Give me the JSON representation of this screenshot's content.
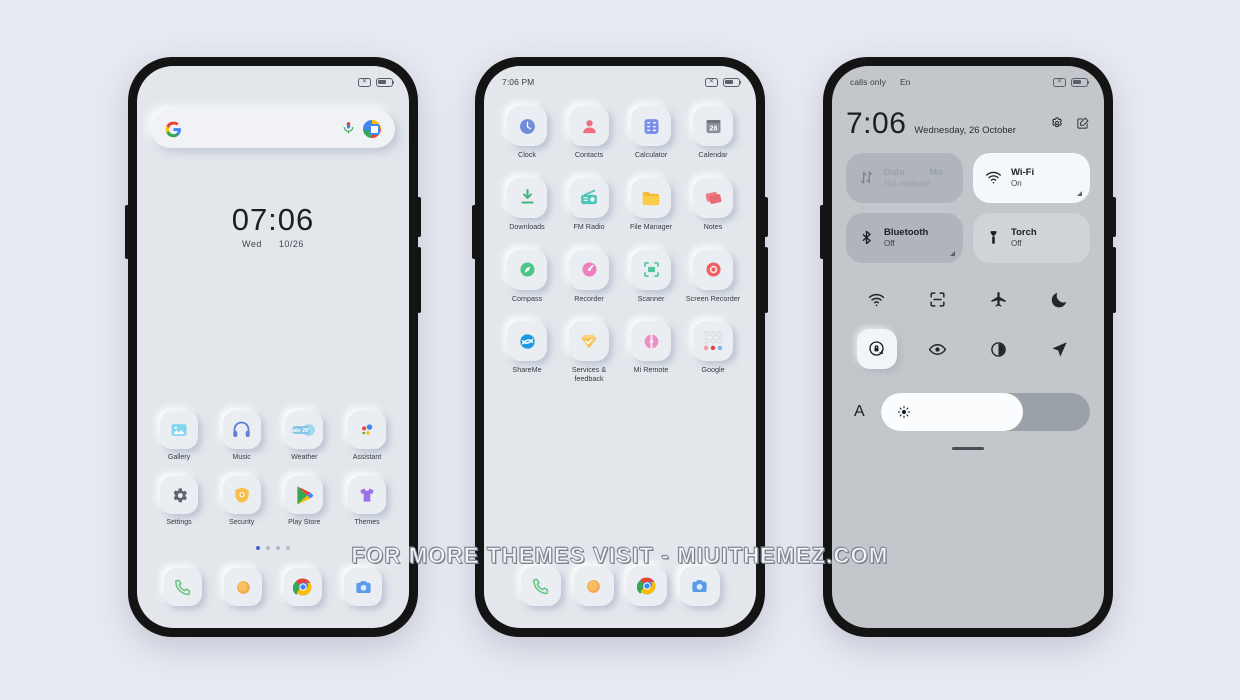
{
  "colors": {
    "page_background": "#e8eaf2",
    "screen_background": "#e3e7ec",
    "control_center_background": "#c3c6cb",
    "accent_dot": "#4a5fc1"
  },
  "watermark": {
    "text": "FOR MORE THEMES VISIT - MIUITHEMEZ.COM"
  },
  "phone1": {
    "status_bar": {
      "left_text": "",
      "mute_icon": "mute-icon",
      "battery_icon": "battery-icon"
    },
    "search": {
      "placeholder": "",
      "value": "",
      "google_icon": "google-g-icon",
      "mic_icon": "microphone-icon",
      "lens_icon": "google-lens-icon"
    },
    "clock_widget": {
      "time": "07:06",
      "day": "Wed",
      "date": "10/26"
    },
    "app_rows": [
      [
        {
          "label": "Gallery",
          "icon": "gallery-icon"
        },
        {
          "label": "Music",
          "icon": "music-icon"
        },
        {
          "label": "Weather",
          "icon": "weather-icon",
          "badge": "late 28°"
        },
        {
          "label": "Assistant",
          "icon": "assistant-icon"
        }
      ],
      [
        {
          "label": "Settings",
          "icon": "settings-gear-icon"
        },
        {
          "label": "Security",
          "icon": "security-shield-icon"
        },
        {
          "label": "Play Store",
          "icon": "play-store-icon"
        },
        {
          "label": "Themes",
          "icon": "themes-shirt-icon"
        }
      ]
    ],
    "page_dots": {
      "count": 4,
      "active_index": 0
    },
    "dock": [
      {
        "label": "Phone",
        "icon": "phone-icon"
      },
      {
        "label": "Messages",
        "icon": "messages-icon"
      },
      {
        "label": "Chrome",
        "icon": "chrome-icon"
      },
      {
        "label": "Camera",
        "icon": "camera-icon"
      }
    ]
  },
  "phone2": {
    "status_bar": {
      "time": "7:06 PM",
      "mute_icon": "mute-icon",
      "battery_icon": "battery-icon"
    },
    "app_rows": [
      [
        {
          "label": "Clock",
          "icon": "clock-icon"
        },
        {
          "label": "Contacts",
          "icon": "contacts-icon"
        },
        {
          "label": "Calculator",
          "icon": "calculator-icon"
        },
        {
          "label": "Calendar",
          "icon": "calendar-icon",
          "day": "26"
        }
      ],
      [
        {
          "label": "Downloads",
          "icon": "downloads-icon"
        },
        {
          "label": "FM Radio",
          "icon": "fm-radio-icon"
        },
        {
          "label": "File Manager",
          "icon": "file-manager-icon"
        },
        {
          "label": "Notes",
          "icon": "notes-icon"
        }
      ],
      [
        {
          "label": "Compass",
          "icon": "compass-icon"
        },
        {
          "label": "Recorder",
          "icon": "recorder-icon"
        },
        {
          "label": "Scanner",
          "icon": "scanner-icon"
        },
        {
          "label": "Screen Recorder",
          "icon": "screen-recorder-icon"
        }
      ],
      [
        {
          "label": "ShareMe",
          "icon": "shareme-icon"
        },
        {
          "label": "Services & feedback",
          "icon": "services-feedback-icon"
        },
        {
          "label": "Mi Remote",
          "icon": "mi-remote-icon"
        },
        {
          "label": "Google",
          "icon": "google-folder-icon"
        }
      ]
    ],
    "dock": [
      {
        "label": "Phone",
        "icon": "phone-icon"
      },
      {
        "label": "Messages",
        "icon": "messages-icon"
      },
      {
        "label": "Chrome",
        "icon": "chrome-icon"
      },
      {
        "label": "Camera",
        "icon": "camera-icon"
      }
    ]
  },
  "phone3": {
    "status_bar": {
      "carrier": "calls only",
      "language": "En",
      "mute_icon": "mute-icon",
      "battery_icon": "battery-icon"
    },
    "header": {
      "time": "7:06",
      "date": "Wednesday, 26 October",
      "settings_icon": "settings-gear-icon",
      "edit_icon": "edit-icon"
    },
    "big_tiles": [
      {
        "title": "Data",
        "title2": "Mo",
        "subtitle": "Not available",
        "icon": "mobile-data-icon",
        "state": "disabled"
      },
      {
        "title": "Wi-Fi",
        "subtitle": "On",
        "icon": "wifi-icon",
        "state": "on"
      },
      {
        "title": "Bluetooth",
        "subtitle": "Off",
        "icon": "bluetooth-icon",
        "state": "off"
      },
      {
        "title": "Torch",
        "subtitle": "Off",
        "icon": "torch-icon",
        "state": "off"
      }
    ],
    "quick_icons_row1": [
      {
        "name": "hotspot-icon",
        "active": false
      },
      {
        "name": "scanner-icon",
        "active": false
      },
      {
        "name": "airplane-mode-icon",
        "active": false
      },
      {
        "name": "dark-mode-moon-icon",
        "active": false
      }
    ],
    "quick_icons_row2": [
      {
        "name": "auto-rotate-lock-icon",
        "active": true
      },
      {
        "name": "reading-mode-eye-icon",
        "active": false
      },
      {
        "name": "contrast-icon",
        "active": false
      },
      {
        "name": "location-icon",
        "active": false
      }
    ],
    "brightness": {
      "auto_label": "A",
      "level_percent": 68,
      "icon": "brightness-sun-icon"
    }
  }
}
